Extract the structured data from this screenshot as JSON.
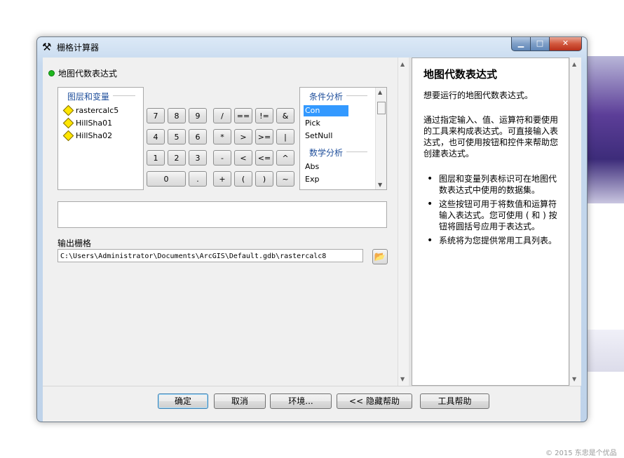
{
  "window": {
    "title": "栅格计算器"
  },
  "left": {
    "section_title": "地图代数表达式",
    "layers_group_title": "图层和变量",
    "layers": [
      "rastercalc5",
      "HillSha01",
      "HillSha02"
    ],
    "calc_buttons": [
      [
        "7",
        "8",
        "9",
        "/",
        "==",
        "!=",
        "&"
      ],
      [
        "4",
        "5",
        "6",
        "*",
        ">",
        ">=",
        "|"
      ],
      [
        "1",
        "2",
        "3",
        "-",
        "<",
        "<=",
        "^"
      ],
      [
        "0",
        ".",
        "+",
        "(",
        ")",
        "~"
      ]
    ],
    "functions": {
      "group1_title": "条件分析",
      "group1_items": [
        "Con",
        "Pick",
        "SetNull"
      ],
      "selected": "Con",
      "group2_title": "数学分析",
      "group2_items": [
        "Abs",
        "Exp"
      ]
    },
    "expression": "",
    "output_label": "输出栅格",
    "output_value": "C:\\Users\\Administrator\\Documents\\ArcGIS\\Default.gdb\\rastercalc8"
  },
  "help": {
    "title": "地图代数表达式",
    "p1": "想要运行的地图代数表达式。",
    "p2": "通过指定输入、值、运算符和要使用的工具来构成表达式。可直接输入表达式，也可使用按钮和控件来帮助您创建表达式。",
    "bullets": [
      "图层和变量列表标识可在地图代数表达式中使用的数据集。",
      "这些按钮可用于将数值和运算符输入表达式。您可使用 ( 和 ) 按钮将圆括号应用于表达式。",
      "系统将为您提供常用工具列表。"
    ]
  },
  "buttons": {
    "ok": "确定",
    "cancel": "取消",
    "env": "环境...",
    "hide_help": "<< 隐藏帮助",
    "tool_help": "工具帮助"
  },
  "watermark": "© 2015 东忠是个优品"
}
